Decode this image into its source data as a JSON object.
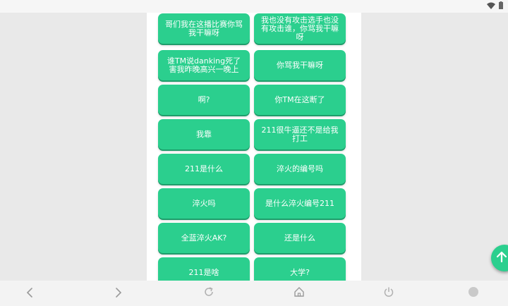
{
  "buttons": [
    {
      "label": "哥们我在这播比赛你骂我干嘛呀"
    },
    {
      "label": "我也没有攻击选手也没有攻击谁，你骂我干嘛呀"
    },
    {
      "label": "谁TM说danking死了害我昨晚高兴一晚上"
    },
    {
      "label": "你骂我干嘛呀"
    },
    {
      "label": "啊?"
    },
    {
      "label": "你TM在这断了"
    },
    {
      "label": "我靠"
    },
    {
      "label": "211很牛逼还不是给我打工"
    },
    {
      "label": "211是什么"
    },
    {
      "label": "淬火的编号吗"
    },
    {
      "label": "淬火吗"
    },
    {
      "label": "是什么淬火编号211"
    },
    {
      "label": "全蓝淬火AK?"
    },
    {
      "label": "还是什么"
    },
    {
      "label": "211是啥"
    },
    {
      "label": "大学?"
    }
  ],
  "colors": {
    "button": "#2bcf8e",
    "button_shadow": "#1f9d6b",
    "panel": "#ffffff",
    "background": "#e9e9e9"
  },
  "icons": {
    "status": [
      "wifi-icon",
      "battery-icon"
    ],
    "scroll_top": "arrow-up-icon",
    "nav": [
      "back-icon",
      "forward-icon",
      "refresh-icon",
      "home-icon",
      "power-icon",
      "circle-icon"
    ]
  }
}
